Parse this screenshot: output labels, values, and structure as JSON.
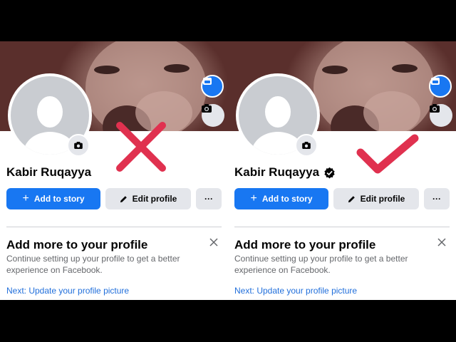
{
  "panels": [
    {
      "id": "left",
      "profile_name": "Kabir Ruqayya",
      "verified": false,
      "add_story_label": "Add to story",
      "edit_profile_label": "Edit profile",
      "more_label": "···",
      "card_title": "Add more to your profile",
      "card_description": "Continue setting up your profile to get a better experience on Facebook.",
      "card_link": "Next: Update your profile picture",
      "overlay_mark": "cross-icon"
    },
    {
      "id": "right",
      "profile_name": "Kabir Ruqayya",
      "verified": true,
      "add_story_label": "Add to story",
      "edit_profile_label": "Edit profile",
      "more_label": "···",
      "card_title": "Add more to your profile",
      "card_description": "Continue setting up your profile to get a better experience on Facebook.",
      "card_link": "Next: Update your profile picture",
      "overlay_mark": "checkmark-icon"
    }
  ],
  "colors": {
    "brand_blue": "#1877f2",
    "mark_red": "#e0314f",
    "button_grey": "#e4e6eb",
    "link_blue": "#216fdb"
  }
}
